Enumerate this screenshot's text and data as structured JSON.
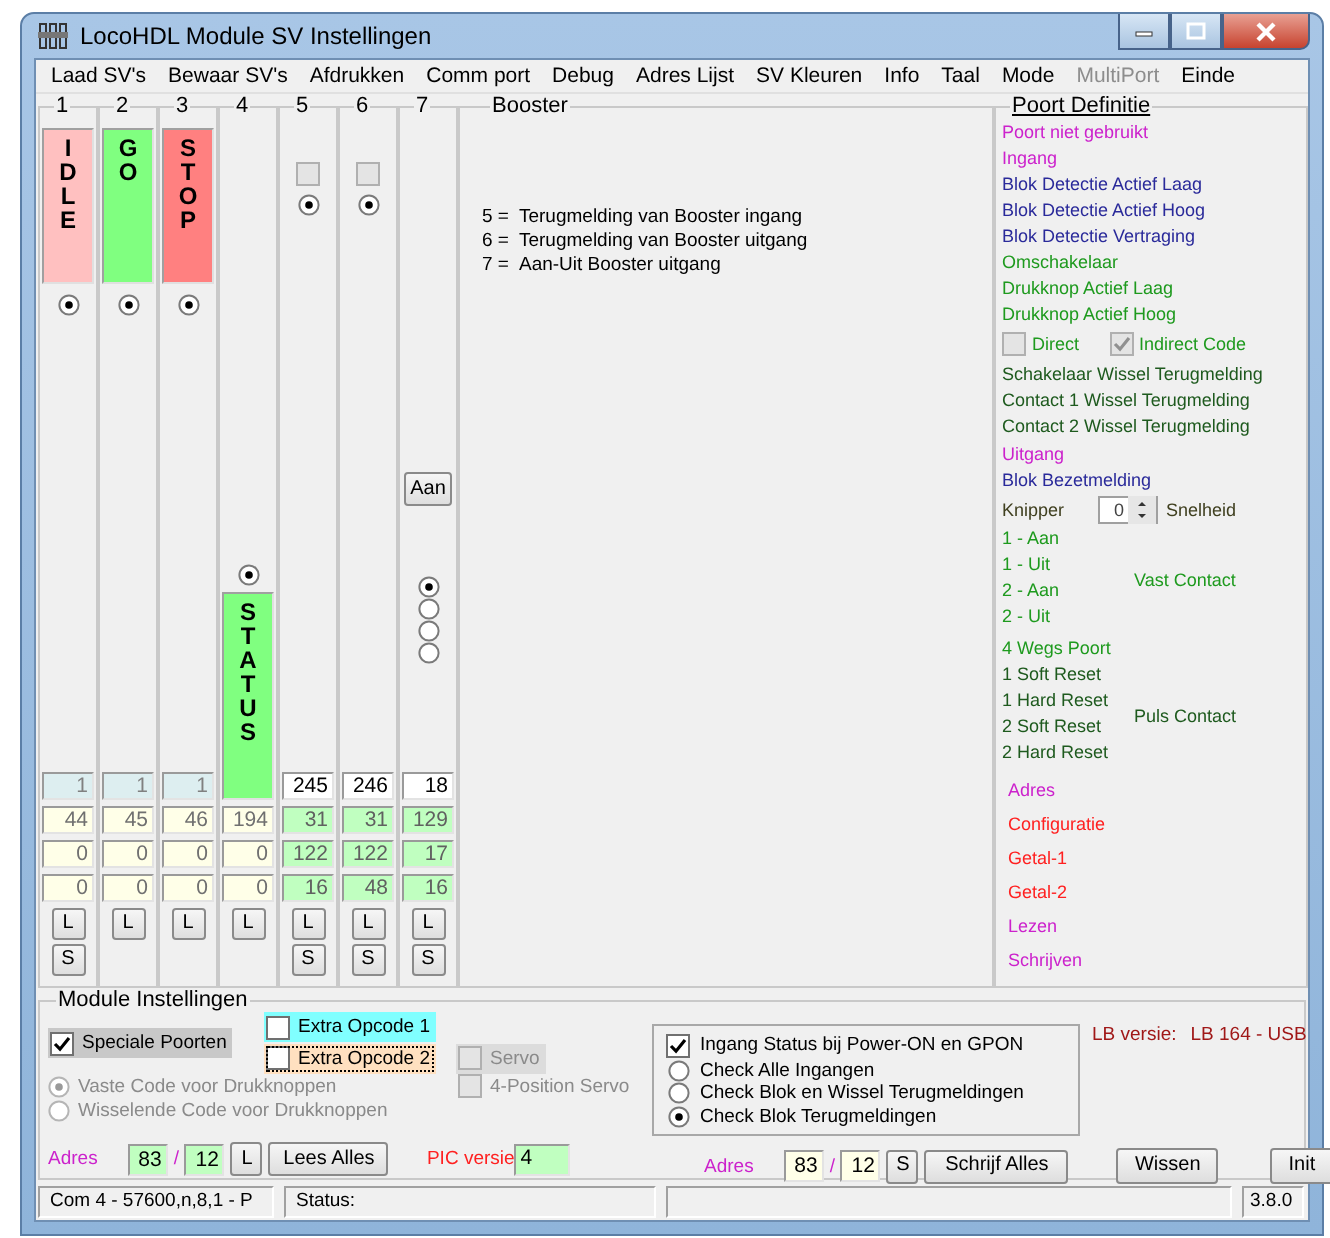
{
  "window": {
    "title": "LocoHDL Module SV Instellingen"
  },
  "menu": [
    {
      "label": "Laad SV's",
      "disabled": false
    },
    {
      "label": "Bewaar SV's",
      "disabled": false
    },
    {
      "label": "Afdrukken",
      "disabled": false
    },
    {
      "label": "Comm port",
      "disabled": false
    },
    {
      "label": "Debug",
      "disabled": false
    },
    {
      "label": "Adres Lijst",
      "disabled": false
    },
    {
      "label": "SV Kleuren",
      "disabled": false
    },
    {
      "label": "Info",
      "disabled": false
    },
    {
      "label": "Taal",
      "disabled": false
    },
    {
      "label": "Mode",
      "disabled": false
    },
    {
      "label": "MultiPort",
      "disabled": true
    },
    {
      "label": "Einde",
      "disabled": false
    }
  ],
  "ports": [
    {
      "number": "1",
      "kind": "label",
      "label": "IDLE",
      "color": "#ffc0c0",
      "radio": {
        "selected": true
      },
      "fields": [
        "1",
        "44",
        "0",
        "0"
      ],
      "buttons": [
        "L",
        "S"
      ]
    },
    {
      "number": "2",
      "kind": "label",
      "label": "GO",
      "color": "#80ff80",
      "radio": {
        "selected": true
      },
      "fields": [
        "1",
        "45",
        "0",
        "0"
      ],
      "buttons": [
        "L"
      ]
    },
    {
      "number": "3",
      "kind": "label",
      "label": "STOP",
      "color": "#ff8080",
      "radio": {
        "selected": true
      },
      "fields": [
        "1",
        "46",
        "0",
        "0"
      ],
      "buttons": [
        "L"
      ]
    },
    {
      "number": "4",
      "kind": "status",
      "label": "STATUS",
      "color": "#80ff80",
      "radio": {
        "selected": true
      },
      "fields": [
        "194",
        "0",
        "0"
      ],
      "buttons": [
        "L"
      ]
    },
    {
      "number": "5",
      "kind": "booster",
      "checked": false,
      "radio": {
        "selected": true
      },
      "fields": [
        "245",
        "31",
        "122",
        "16"
      ],
      "buttons": [
        "L",
        "S"
      ]
    },
    {
      "number": "6",
      "kind": "booster",
      "checked": false,
      "radio": {
        "selected": true
      },
      "fields": [
        "246",
        "31",
        "122",
        "48"
      ],
      "buttons": [
        "L",
        "S"
      ]
    },
    {
      "number": "7",
      "kind": "switch",
      "button": "Aan",
      "radios": [
        {
          "selected": true
        },
        {
          "selected": false
        },
        {
          "selected": false
        },
        {
          "selected": false
        }
      ],
      "fields": [
        "18",
        "129",
        "17",
        "16"
      ],
      "buttons": [
        "L",
        "S"
      ]
    }
  ],
  "booster": {
    "title": "Booster",
    "lines": [
      {
        "key": "5 =",
        "text": "Terugmelding van Booster ingang"
      },
      {
        "key": "6 =",
        "text": "Terugmelding van Booster uitgang"
      },
      {
        "key": "7 =",
        "text": "Aan-Uit Booster uitgang"
      }
    ]
  },
  "poort_definitie": {
    "title": "Poort Definitie",
    "top": [
      {
        "kind": "text",
        "text": "Poort niet gebruikt",
        "color": "#cc22cc"
      },
      {
        "kind": "text",
        "text": "Ingang",
        "color": "#cc22cc"
      },
      {
        "kind": "text",
        "text": "Blok Detectie Actief Laag",
        "color": "#2a2a9a"
      },
      {
        "kind": "text",
        "text": "Blok Detectie Actief Hoog",
        "color": "#2a2a9a"
      },
      {
        "kind": "text",
        "text": "Blok Detectie Vertraging",
        "color": "#2a2a9a"
      },
      {
        "kind": "text",
        "text": "Omschakelaar",
        "color": "#1e9a1e"
      },
      {
        "kind": "text",
        "text": "Drukknop Actief Laag",
        "color": "#1e9a1e"
      },
      {
        "kind": "text",
        "text": "Drukknop Actief Hoog",
        "color": "#1e9a1e"
      },
      {
        "kind": "checks",
        "color": "#1e9a1e",
        "items": [
          {
            "label": "Direct",
            "checked": false
          },
          {
            "label": "Indirect Code",
            "checked": true
          }
        ]
      },
      {
        "kind": "text",
        "text": "Schakelaar Wissel Terugmelding",
        "color": "#1e5a1e"
      },
      {
        "kind": "text",
        "text": "Contact 1 Wissel Terugmelding",
        "color": "#1e5a1e"
      },
      {
        "kind": "text",
        "text": "Contact 2 Wissel Terugmelding",
        "color": "#1e5a1e"
      }
    ],
    "bottom": [
      {
        "kind": "text",
        "text": "Uitgang",
        "color": "#cc22cc"
      },
      {
        "kind": "text",
        "text": "Blok Bezetmelding",
        "color": "#2a2a9a"
      },
      {
        "kind": "knipper",
        "label": "Knipper",
        "value": "0",
        "unit": "Snelheid",
        "color": "#404020"
      },
      {
        "kind": "group",
        "color": "#1e9a1e",
        "lines": [
          "1 - Aan",
          "1 - Uit",
          "2 - Aan",
          "2 - Uit"
        ],
        "side": "Vast Contact"
      },
      {
        "kind": "text",
        "text": "4 Wegs Poort",
        "color": "#1e9a1e"
      },
      {
        "kind": "group",
        "color": "#1e5a1e",
        "lines": [
          "1 Soft Reset",
          "1 Hard Reset",
          "2 Soft Reset",
          "2 Hard Reset"
        ],
        "side": "Puls Contact"
      },
      {
        "kind": "row",
        "text": "Adres",
        "color": "#cc22cc"
      },
      {
        "kind": "row",
        "text": "Configuratie",
        "color": "#ff2020"
      },
      {
        "kind": "row",
        "text": "Getal-1",
        "color": "#ff2020"
      },
      {
        "kind": "row",
        "text": "Getal-2",
        "color": "#ff2020"
      },
      {
        "kind": "row",
        "text": "Lezen",
        "color": "#cc22cc"
      },
      {
        "kind": "row",
        "text": "Schrijven",
        "color": "#cc22cc"
      }
    ]
  },
  "module": {
    "title": "Module Instellingen",
    "speciale": {
      "label": "Speciale Poorten",
      "checked": true
    },
    "extra": [
      {
        "label": "Extra Opcode 1",
        "checked": false,
        "color": "#80ffff"
      },
      {
        "label": "Extra Opcode 2",
        "checked": false,
        "color": "#ffe0c0"
      }
    ],
    "servo": [
      {
        "label": "Servo",
        "checked": false,
        "disabled": true
      },
      {
        "label": "4-Position Servo",
        "checked": false,
        "disabled": true
      }
    ],
    "code_radios": [
      {
        "label": "Vaste Code voor Drukknoppen",
        "selected": true,
        "disabled": true
      },
      {
        "label": "Wisselende Code voor Drukknoppen",
        "selected": false,
        "disabled": true
      }
    ],
    "read": {
      "label": "Adres",
      "address": "83",
      "separator": "/",
      "sub": "12",
      "button": "L",
      "action": "Lees Alles"
    },
    "pic": {
      "label": "PIC versie",
      "value": "4"
    },
    "power_on": {
      "label": "Ingang Status bij Power-ON en GPON",
      "checked": true,
      "options": [
        {
          "label": "Check Alle Ingangen",
          "selected": false
        },
        {
          "label": "Check Blok en Wissel Terugmeldingen",
          "selected": false
        },
        {
          "label": "Check Blok Terugmeldingen",
          "selected": true
        }
      ]
    },
    "lb": {
      "label": "LB versie:",
      "value": "LB 164 - USB"
    },
    "write": {
      "label": "Adres",
      "address": "83",
      "separator": "/",
      "sub": "12",
      "button": "S",
      "action": "Schrijf Alles"
    },
    "buttons": [
      "Wissen",
      "Init"
    ]
  },
  "status_bar": {
    "connection": "Com 4 - 57600,n,8,1 - P",
    "status": "Status:",
    "version": "3.8.0"
  }
}
